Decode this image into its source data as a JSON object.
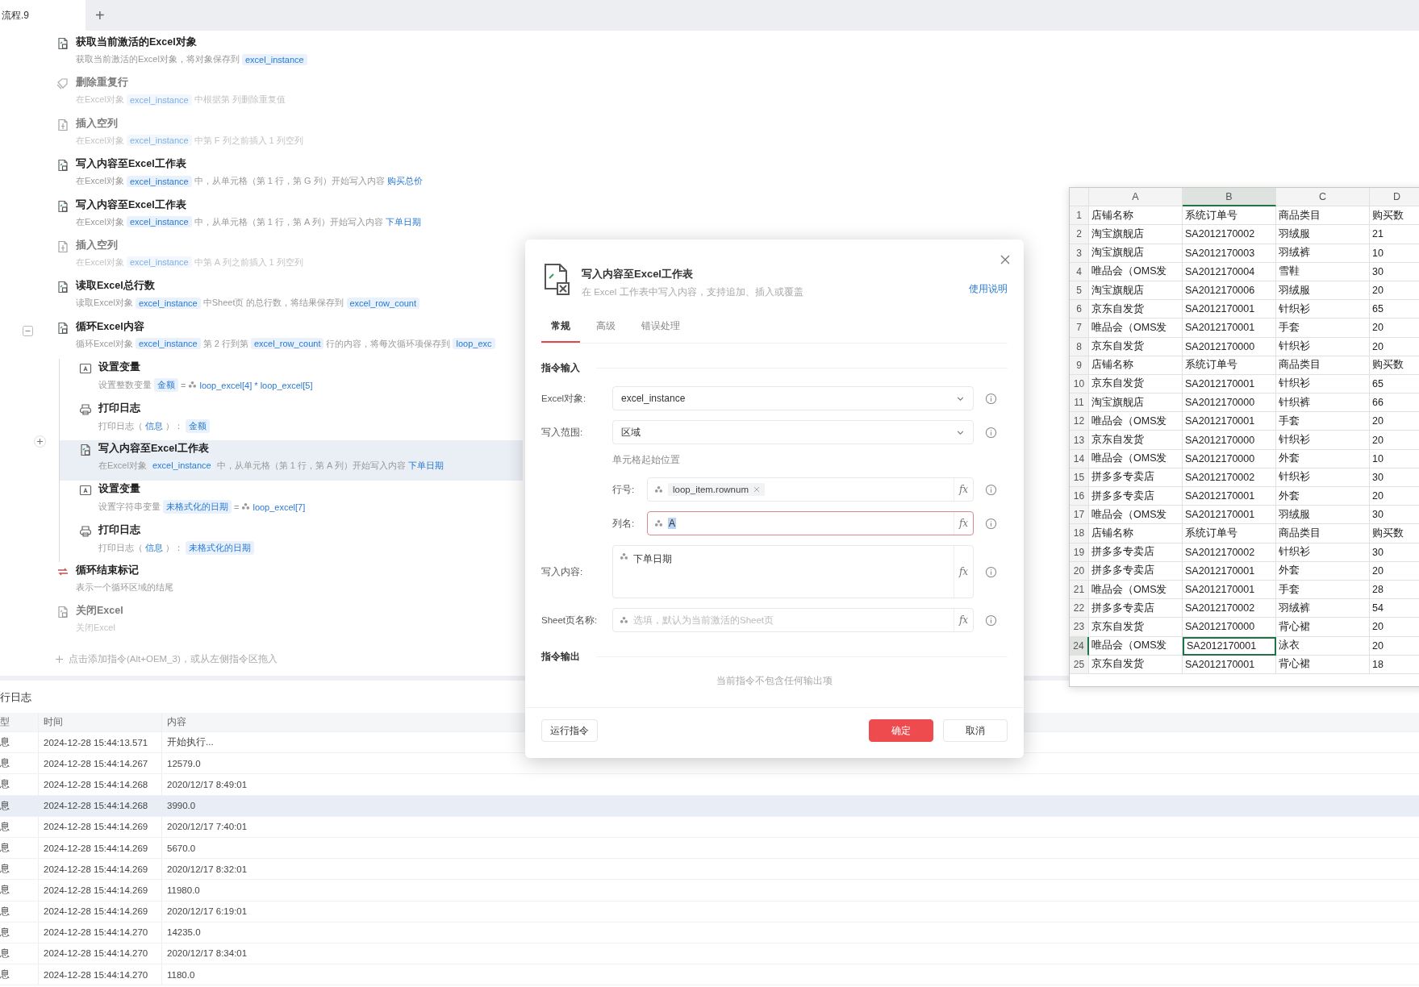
{
  "tab_bar": {
    "tabs": [
      {
        "label": "流程.9",
        "selected": true
      }
    ],
    "add_label": "+"
  },
  "steps": [
    {
      "kind": "excel",
      "title": "获取当前激活的Excel对象",
      "disabled": false,
      "selected": false,
      "expanded": false,
      "desc": [
        {
          "kind": "text",
          "text": "获取当前激活的Excel对象，将对象保存到"
        },
        {
          "kind": "var",
          "text": "excel_instance"
        }
      ]
    },
    {
      "kind": "dedupe",
      "title": "删除重复行",
      "disabled": true,
      "selected": false,
      "expanded": false,
      "desc": [
        {
          "kind": "text",
          "text": "在Excel对象"
        },
        {
          "kind": "var",
          "text": "excel_instance"
        },
        {
          "kind": "text",
          "text": "中根据第 列删除重复值"
        }
      ]
    },
    {
      "kind": "insert",
      "title": "插入空列",
      "disabled": true,
      "selected": false,
      "expanded": false,
      "desc": [
        {
          "kind": "text",
          "text": "在Excel对象"
        },
        {
          "kind": "var",
          "text": "excel_instance"
        },
        {
          "kind": "text",
          "text": "中第 F 列之前插入 1 列空列"
        }
      ]
    },
    {
      "kind": "excel",
      "title": "写入内容至Excel工作表",
      "disabled": false,
      "selected": false,
      "expanded": false,
      "desc": [
        {
          "kind": "text",
          "text": "在Excel对象"
        },
        {
          "kind": "var",
          "text": "excel_instance"
        },
        {
          "kind": "text",
          "text": "中，从单元格（第 1 行，第 G 列）开始写入内容"
        },
        {
          "kind": "link",
          "text": "购买总价"
        }
      ]
    },
    {
      "kind": "excel",
      "title": "写入内容至Excel工作表",
      "disabled": false,
      "selected": false,
      "expanded": false,
      "desc": [
        {
          "kind": "text",
          "text": "在Excel对象"
        },
        {
          "kind": "var",
          "text": "excel_instance"
        },
        {
          "kind": "text",
          "text": "中，从单元格（第 1 行，第 A 列）开始写入内容"
        },
        {
          "kind": "link",
          "text": "下单日期"
        }
      ]
    },
    {
      "kind": "insert",
      "title": "插入空列",
      "disabled": true,
      "selected": false,
      "expanded": false,
      "desc": [
        {
          "kind": "text",
          "text": "在Excel对象"
        },
        {
          "kind": "var",
          "text": "excel_instance"
        },
        {
          "kind": "text",
          "text": "中第 A 列之前插入 1 列空列"
        }
      ]
    },
    {
      "kind": "excel",
      "title": "读取Excel总行数",
      "disabled": false,
      "selected": false,
      "expanded": false,
      "desc": [
        {
          "kind": "text",
          "text": "读取Excel对象"
        },
        {
          "kind": "var",
          "text": "excel_instance"
        },
        {
          "kind": "text",
          "text": "中Sheet页 的总行数，将结果保存到"
        },
        {
          "kind": "var",
          "text": "excel_row_count"
        }
      ]
    },
    {
      "kind": "excel",
      "title": "循环Excel内容",
      "disabled": false,
      "selected": false,
      "expanded": true,
      "desc": [
        {
          "kind": "text",
          "text": "循环Excel对象"
        },
        {
          "kind": "var",
          "text": "excel_instance"
        },
        {
          "kind": "text",
          "text": "第 2 行到第"
        },
        {
          "kind": "var",
          "text": "excel_row_count"
        },
        {
          "kind": "text",
          "text": "行的内容，将每次循环项保存到"
        },
        {
          "kind": "var",
          "text": "loop_exc"
        }
      ],
      "children": [
        {
          "kind": "variable",
          "title": "设置变量",
          "disabled": false,
          "selected": false,
          "desc": [
            {
              "kind": "text",
              "text": "设置整数变量"
            },
            {
              "kind": "var",
              "text": "金额"
            },
            {
              "kind": "text",
              "text": "="
            },
            {
              "kind": "expr",
              "text": "loop_excel[4] * loop_excel[5]"
            }
          ]
        },
        {
          "kind": "log",
          "title": "打印日志",
          "disabled": false,
          "selected": false,
          "desc": [
            {
              "kind": "text",
              "text": "打印日志（"
            },
            {
              "kind": "link",
              "text": "信息"
            },
            {
              "kind": "text",
              "text": "）："
            },
            {
              "kind": "var",
              "text": "金额"
            }
          ]
        },
        {
          "kind": "excel",
          "title": "写入内容至Excel工作表",
          "disabled": false,
          "selected": true,
          "desc": [
            {
              "kind": "text",
              "text": "在Excel对象"
            },
            {
              "kind": "var",
              "text": "excel_instance"
            },
            {
              "kind": "text",
              "text": "中，从单元格（第 1 行，第 A 列）开始写入内容"
            },
            {
              "kind": "link",
              "text": "下单日期"
            }
          ]
        },
        {
          "kind": "variable",
          "title": "设置变量",
          "disabled": false,
          "selected": false,
          "desc": [
            {
              "kind": "text",
              "text": "设置字符串变量"
            },
            {
              "kind": "var",
              "text": "未格式化的日期"
            },
            {
              "kind": "text",
              "text": "="
            },
            {
              "kind": "expr",
              "text": "loop_excel[7]"
            }
          ]
        },
        {
          "kind": "log",
          "title": "打印日志",
          "disabled": false,
          "selected": false,
          "desc": [
            {
              "kind": "text",
              "text": "打印日志（"
            },
            {
              "kind": "link",
              "text": "信息"
            },
            {
              "kind": "text",
              "text": "）："
            },
            {
              "kind": "var",
              "text": "未格式化的日期"
            }
          ]
        }
      ]
    },
    {
      "kind": "loop_end",
      "title": "循环结束标记",
      "disabled": false,
      "selected": false,
      "expanded": false,
      "desc": [
        {
          "kind": "text",
          "text": "表示一个循环区域的结尾"
        }
      ]
    },
    {
      "kind": "excel",
      "title": "关闭Excel",
      "disabled": true,
      "selected": false,
      "expanded": false,
      "desc": [
        {
          "kind": "text",
          "text": "关闭Excel"
        }
      ]
    }
  ],
  "add_hint": "点击添加指令(Alt+OEM_3)，或从左侧指令区拖入",
  "log": {
    "title": "行日志",
    "columns": [
      "型",
      "时间",
      "内容"
    ],
    "rows": [
      {
        "type": "息",
        "time": "2024-12-28 15:44:13.571",
        "content": "开始执行...",
        "selected": false
      },
      {
        "type": "息",
        "time": "2024-12-28 15:44:14.267",
        "content": "12579.0",
        "selected": false
      },
      {
        "type": "息",
        "time": "2024-12-28 15:44:14.268",
        "content": "2020/12/17 8:49:01",
        "selected": false
      },
      {
        "type": "息",
        "time": "2024-12-28 15:44:14.268",
        "content": "3990.0",
        "selected": true
      },
      {
        "type": "息",
        "time": "2024-12-28 15:44:14.269",
        "content": "2020/12/17 7:40:01",
        "selected": false
      },
      {
        "type": "息",
        "time": "2024-12-28 15:44:14.269",
        "content": "5670.0",
        "selected": false
      },
      {
        "type": "息",
        "time": "2024-12-28 15:44:14.269",
        "content": "2020/12/17 8:32:01",
        "selected": false
      },
      {
        "type": "息",
        "time": "2024-12-28 15:44:14.269",
        "content": "11980.0",
        "selected": false
      },
      {
        "type": "息",
        "time": "2024-12-28 15:44:14.269",
        "content": "2020/12/17 6:19:01",
        "selected": false
      },
      {
        "type": "息",
        "time": "2024-12-28 15:44:14.270",
        "content": "14235.0",
        "selected": false
      },
      {
        "type": "息",
        "time": "2024-12-28 15:44:14.270",
        "content": "2020/12/17 8:34:01",
        "selected": false
      },
      {
        "type": "息",
        "time": "2024-12-28 15:44:14.270",
        "content": "1180.0",
        "selected": false
      }
    ]
  },
  "dialog": {
    "title": "写入内容至Excel工作表",
    "subtitle": "在 Excel 工作表中写入内容，支持追加、插入或覆盖",
    "help_link": "使用说明",
    "tabs": [
      {
        "label": "常规",
        "selected": true
      },
      {
        "label": "高级",
        "selected": false
      },
      {
        "label": "错误处理",
        "selected": false
      }
    ],
    "input_section": "指令输入",
    "inputs": [
      {
        "kind": "select",
        "label": "Excel对象:",
        "value": "excel_instance"
      },
      {
        "kind": "select",
        "label": "写入范围:",
        "value": "区域"
      },
      {
        "kind": "group",
        "label": "单元格起始位置",
        "fields": [
          {
            "kind": "token",
            "label": "行号:",
            "chip": "loop_item.rownum",
            "formula": "fx",
            "focused": false
          },
          {
            "kind": "text",
            "label": "列名:",
            "value": "A",
            "formula": "fx",
            "focused": true
          }
        ]
      },
      {
        "kind": "textarea",
        "label": "写入内容:",
        "chip": "下单日期",
        "formula": "fx",
        "focused": false
      },
      {
        "kind": "text",
        "label": "Sheet页名称:",
        "placeholder": "选填，默认为当前激活的Sheet页",
        "formula": "fx",
        "focused": false
      }
    ],
    "output_section": "指令输出",
    "output_empty": "当前指令不包含任何输出项",
    "run_button": "运行指令",
    "confirm_button": "确定",
    "cancel_button": "取消"
  },
  "excel": {
    "columns": [
      {
        "label": "A",
        "selected": false
      },
      {
        "label": "B",
        "selected": true
      },
      {
        "label": "C",
        "selected": false
      },
      {
        "label": "D",
        "selected": false
      }
    ],
    "rows": [
      {
        "number": "1",
        "cells": [
          "店铺名称",
          "系统订单号",
          "商品类目",
          "购买数"
        ],
        "selected": false
      },
      {
        "number": "2",
        "cells": [
          "淘宝旗舰店",
          "SA2012170002",
          "羽绒服",
          "21"
        ],
        "selected": false
      },
      {
        "number": "3",
        "cells": [
          "淘宝旗舰店",
          "SA2012170003",
          "羽绒裤",
          "10"
        ],
        "selected": false
      },
      {
        "number": "4",
        "cells": [
          "唯品会（OMS发",
          "SA2012170004",
          "雪鞋",
          "30"
        ],
        "selected": false
      },
      {
        "number": "5",
        "cells": [
          "淘宝旗舰店",
          "SA2012170006",
          "羽绒服",
          "20"
        ],
        "selected": false
      },
      {
        "number": "6",
        "cells": [
          "京东自发货",
          "SA2012170001",
          "针织衫",
          "65"
        ],
        "selected": false
      },
      {
        "number": "7",
        "cells": [
          "唯品会（OMS发",
          "SA2012170001",
          "手套",
          "20"
        ],
        "selected": false
      },
      {
        "number": "8",
        "cells": [
          "京东自发货",
          "SA2012170000",
          "针织衫",
          "20"
        ],
        "selected": false
      },
      {
        "number": "9",
        "cells": [
          "店铺名称",
          "系统订单号",
          "商品类目",
          "购买数"
        ],
        "selected": false
      },
      {
        "number": "10",
        "cells": [
          "京东自发货",
          "SA2012170001",
          "针织衫",
          "65"
        ],
        "selected": false
      },
      {
        "number": "11",
        "cells": [
          "淘宝旗舰店",
          "SA2012170000",
          "针织裤",
          "66"
        ],
        "selected": false
      },
      {
        "number": "12",
        "cells": [
          "唯品会（OMS发",
          "SA2012170001",
          "手套",
          "20"
        ],
        "selected": false
      },
      {
        "number": "13",
        "cells": [
          "京东自发货",
          "SA2012170000",
          "针织衫",
          "20"
        ],
        "selected": false
      },
      {
        "number": "14",
        "cells": [
          "唯品会（OMS发",
          "SA2012170000",
          "外套",
          "10"
        ],
        "selected": false
      },
      {
        "number": "15",
        "cells": [
          "拼多多专卖店",
          "SA2012170002",
          "针织衫",
          "30"
        ],
        "selected": false
      },
      {
        "number": "16",
        "cells": [
          "拼多多专卖店",
          "SA2012170001",
          "外套",
          "20"
        ],
        "selected": false
      },
      {
        "number": "17",
        "cells": [
          "唯品会（OMS发",
          "SA2012170001",
          "羽绒服",
          "30"
        ],
        "selected": false
      },
      {
        "number": "18",
        "cells": [
          "店铺名称",
          "系统订单号",
          "商品类目",
          "购买数"
        ],
        "selected": false
      },
      {
        "number": "19",
        "cells": [
          "拼多多专卖店",
          "SA2012170002",
          "针织衫",
          "30"
        ],
        "selected": false
      },
      {
        "number": "20",
        "cells": [
          "拼多多专卖店",
          "SA2012170001",
          "外套",
          "20"
        ],
        "selected": false
      },
      {
        "number": "21",
        "cells": [
          "唯品会（OMS发",
          "SA2012170001",
          "手套",
          "28"
        ],
        "selected": false
      },
      {
        "number": "22",
        "cells": [
          "拼多多专卖店",
          "SA2012170002",
          "羽绒裤",
          "54"
        ],
        "selected": false
      },
      {
        "number": "23",
        "cells": [
          "京东自发货",
          "SA2012170000",
          "背心裙",
          "20"
        ],
        "selected": false
      },
      {
        "number": "24",
        "cells": [
          "唯品会（OMS发",
          "SA2012170001",
          "泳衣",
          "20"
        ],
        "selected": true
      },
      {
        "number": "25",
        "cells": [
          "京东自发货",
          "SA2012170001",
          "背心裙",
          "18"
        ],
        "selected": false
      }
    ]
  }
}
